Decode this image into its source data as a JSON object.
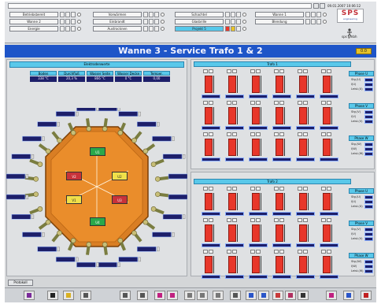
{
  "header": {
    "timestamp": "09.01.2007 10:06:12",
    "logo_text": "SPS",
    "logo_sub": "engineering",
    "user_label": "sps gmbh",
    "nav_rows": [
      [
        "Betriebsbereit",
        "Vorwärmen",
        "Schachtel",
        "Wanne 1"
      ],
      [
        "Wanne 2",
        "Einbrandt",
        "Glasbrille",
        "Blendung"
      ],
      [
        "Energie",
        "Austrocknen",
        "Projekt 5",
        ""
      ]
    ]
  },
  "title": {
    "text": "Wanne 3 - Service Trafo 1 & 2",
    "indicator": "0.0"
  },
  "left_panel": {
    "header": "Elektrodenwerte",
    "table_headers": [
      "Boden",
      "Durchfluß",
      "Wasser Seite",
      "Wasser Decke",
      "Temper."
    ],
    "table_values": [
      "338 °C",
      "20,3 %",
      "866 °C",
      "0 °C",
      "0,00"
    ],
    "center_labels": [
      "U1",
      "U2",
      "U3",
      "U4",
      "V1",
      "V2",
      "W1",
      "W2"
    ]
  },
  "trafo1": {
    "header": "Trafo 1",
    "phases": [
      {
        "label": "Phase U",
        "values": [
          "Stg.(U)",
          "I(U)",
          "Leist.(U)"
        ]
      },
      {
        "label": "Phase V",
        "values": [
          "Stg.(V)",
          "I(V)",
          "Leist.(V)"
        ]
      },
      {
        "label": "Phase W",
        "values": [
          "Stg.(W)",
          "I(W)",
          "Leist.(W)"
        ]
      }
    ]
  },
  "trafo2": {
    "header": "Trafo 2",
    "phases": [
      {
        "label": "Phase U",
        "values": [
          "Stg.(U)",
          "I(U)",
          "Leist.(U)"
        ]
      },
      {
        "label": "Phase V",
        "values": [
          "Stg.(V)",
          "I(V)",
          "Leist.(V)"
        ]
      },
      {
        "label": "Phase W",
        "values": [
          "Stg.(W)",
          "I(W)",
          "Leist.(W)"
        ]
      }
    ]
  },
  "bottom_button": "Protokoll",
  "colors": {
    "accent_blue": "#1e55c8",
    "cyan": "#59c8ea",
    "navy": "#1d1f6a",
    "red": "#e8372a",
    "orange": "#e88a22"
  }
}
